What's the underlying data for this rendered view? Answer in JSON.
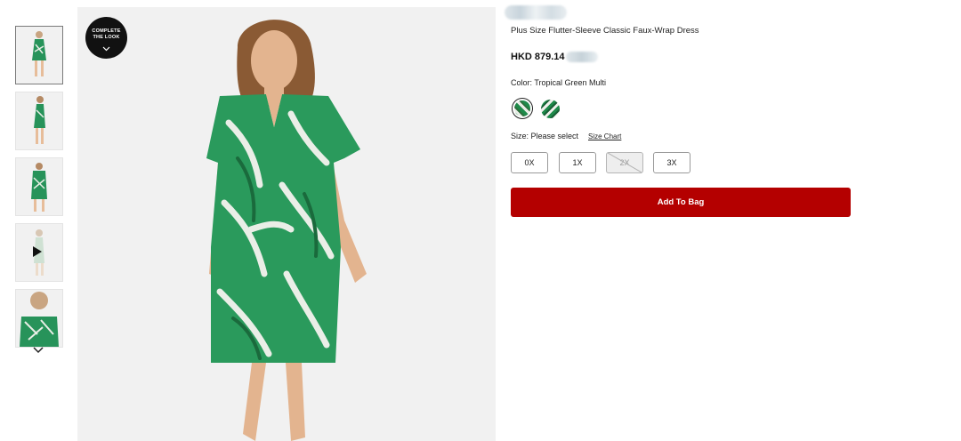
{
  "gallery": {
    "complete_look_lines": [
      "COMPLETE",
      "THE LOOK"
    ]
  },
  "product": {
    "title": "Plus Size Flutter-Sleeve Classic Faux-Wrap Dress",
    "price": "HKD 879.14"
  },
  "color": {
    "label": "Color:",
    "selected": "Tropical Green Multi"
  },
  "size": {
    "label": "Size:",
    "prompt": "Please select",
    "chart_link": "Size Chart",
    "options": [
      {
        "label": "0X",
        "available": true
      },
      {
        "label": "1X",
        "available": true
      },
      {
        "label": "2X",
        "available": false
      },
      {
        "label": "3X",
        "available": true
      }
    ]
  },
  "cta": {
    "add_to_bag": "Add To Bag"
  },
  "colors": {
    "cta": "#b40000",
    "dress_green": "#1e8a4a",
    "image_bg": "#f1f1f1"
  }
}
